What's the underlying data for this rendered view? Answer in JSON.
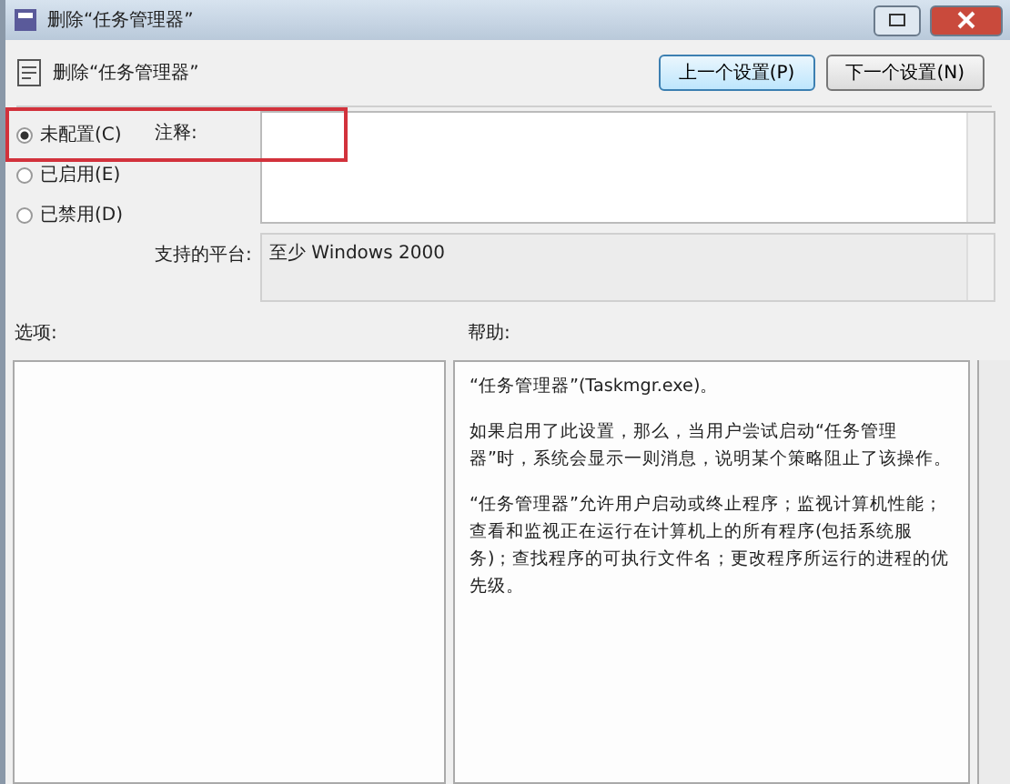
{
  "window": {
    "title": "删除“任务管理器”"
  },
  "header": {
    "title": "删除“任务管理器”"
  },
  "nav_buttons": [
    "上一个设置(P)",
    "下一个设置(N)"
  ],
  "state_options": [
    {
      "label": "未配置(C)",
      "selected": true
    },
    {
      "label": "已启用(E)",
      "selected": false
    },
    {
      "label": "已禁用(D)",
      "selected": false
    }
  ],
  "comment": {
    "label": "注释:"
  },
  "platform": {
    "label": "支持的平台:",
    "value": "至少 Windows 2000"
  },
  "options": {
    "label": "选项:"
  },
  "help": {
    "label": "帮助:",
    "paragraphs": [
      "“任务管理器”(Taskmgr.exe)。",
      "如果启用了此设置，那么，当用户尝试启动“任务管理器”时，系统会显示一则消息，说明某个策略阻止了该操作。",
      "“任务管理器”允许用户启动或终止程序；监视计算机性能；查看和监视正在运行在计算机上的所有程序(包括系统服务)；查找程序的可执行文件名；更改程序所运行的进程的优先级。"
    ]
  }
}
